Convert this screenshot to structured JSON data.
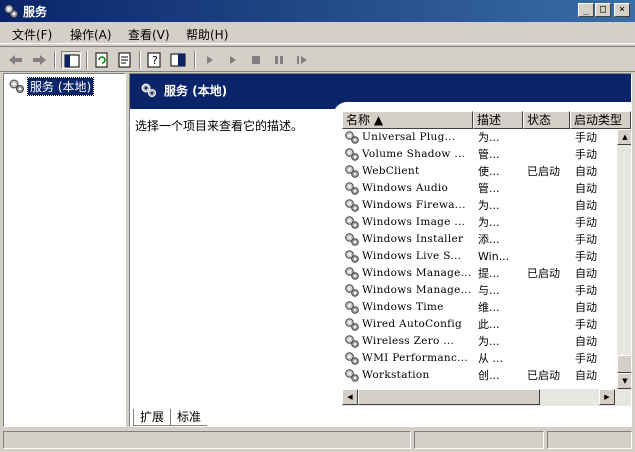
{
  "window": {
    "title": "服务",
    "minimize": "_",
    "maximize": "□",
    "close": "×"
  },
  "menu": [
    {
      "label": "文件(F)"
    },
    {
      "label": "操作(A)"
    },
    {
      "label": "查看(V)"
    },
    {
      "label": "帮助(H)"
    }
  ],
  "toolbar": {
    "icons": [
      "back-arrow-icon",
      "forward-arrow-icon",
      "show-tree-icon",
      "refresh-icon",
      "export-list-icon",
      "help-icon",
      "properties-icon",
      "start-service-icon",
      "start-service-alt-icon",
      "stop-service-icon",
      "pause-service-icon",
      "restart-service-icon"
    ]
  },
  "tree": {
    "root_label": "服务 (本地)"
  },
  "panel": {
    "header_title": "服务 (本地)",
    "description": "选择一个项目来查看它的描述。"
  },
  "list": {
    "columns": [
      "名称 ▲",
      "描述",
      "状态",
      "启动类型"
    ],
    "rows": [
      {
        "name": "Universal Plug...",
        "desc": "为...",
        "status": "",
        "start": "手动"
      },
      {
        "name": "Volume Shadow ...",
        "desc": "管...",
        "status": "",
        "start": "手动"
      },
      {
        "name": "WebClient",
        "desc": "使...",
        "status": "已启动",
        "start": "自动"
      },
      {
        "name": "Windows Audio",
        "desc": "管...",
        "status": "",
        "start": "自动"
      },
      {
        "name": "Windows Firewa...",
        "desc": "为...",
        "status": "",
        "start": "自动"
      },
      {
        "name": "Windows Image ...",
        "desc": "为...",
        "status": "",
        "start": "手动"
      },
      {
        "name": "Windows Installer",
        "desc": "添...",
        "status": "",
        "start": "手动"
      },
      {
        "name": "Windows Live S...",
        "desc": "Win...",
        "status": "",
        "start": "手动"
      },
      {
        "name": "Windows Manage...",
        "desc": "提...",
        "status": "已启动",
        "start": "自动"
      },
      {
        "name": "Windows Manage...",
        "desc": "与...",
        "status": "",
        "start": "手动"
      },
      {
        "name": "Windows Time",
        "desc": "维...",
        "status": "",
        "start": "自动"
      },
      {
        "name": "Wired AutoConfig",
        "desc": "此...",
        "status": "",
        "start": "手动"
      },
      {
        "name": "Wireless Zero ...",
        "desc": "为...",
        "status": "",
        "start": "自动"
      },
      {
        "name": "WMI Performanc...",
        "desc": "从 ...",
        "status": "",
        "start": "手动"
      },
      {
        "name": "Workstation",
        "desc": "创...",
        "status": "已启动",
        "start": "自动"
      }
    ]
  },
  "tabs": [
    {
      "label": "扩展"
    },
    {
      "label": "标准"
    }
  ],
  "scroll_arrows": {
    "up": "▲",
    "down": "▼",
    "left": "◀",
    "right": "▶"
  }
}
